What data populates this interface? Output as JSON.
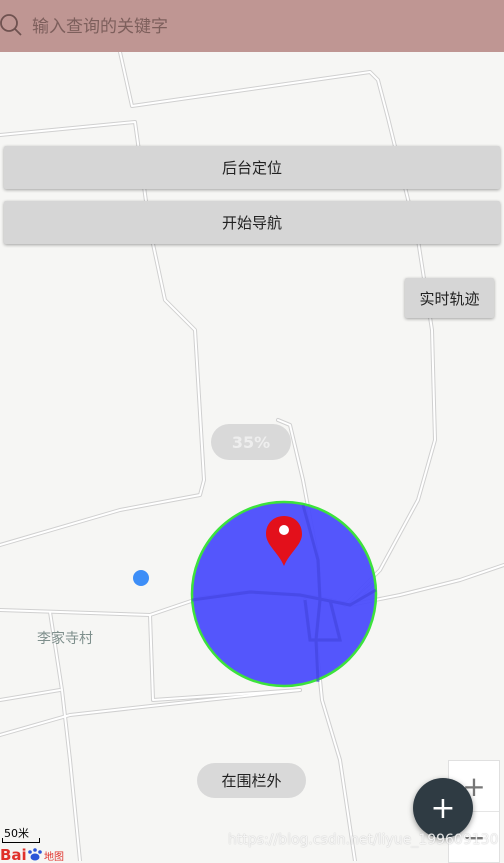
{
  "search": {
    "placeholder": "输入查询的关键字",
    "icon": "search-icon"
  },
  "buttons": {
    "background_locate": "后台定位",
    "start_navigation": "开始导航",
    "realtime_track": "实时轨迹"
  },
  "map": {
    "place_label": "李家寺村",
    "progress_label": "35%",
    "fence_status": "在围栏外",
    "fence_fill": "#4b4dfc",
    "fence_stroke": "#3ce23c",
    "marker_color": "#e3101b",
    "location_dot": "#3d8ef7"
  },
  "controls": {
    "fab_label": "+",
    "zoom_in": "+",
    "zoom_out": "−"
  },
  "scale": {
    "label": "50米"
  },
  "watermark": "https://blog.csdn.net/liyue_199609130",
  "logo": {
    "text": "Bai",
    "text2": "地图"
  }
}
